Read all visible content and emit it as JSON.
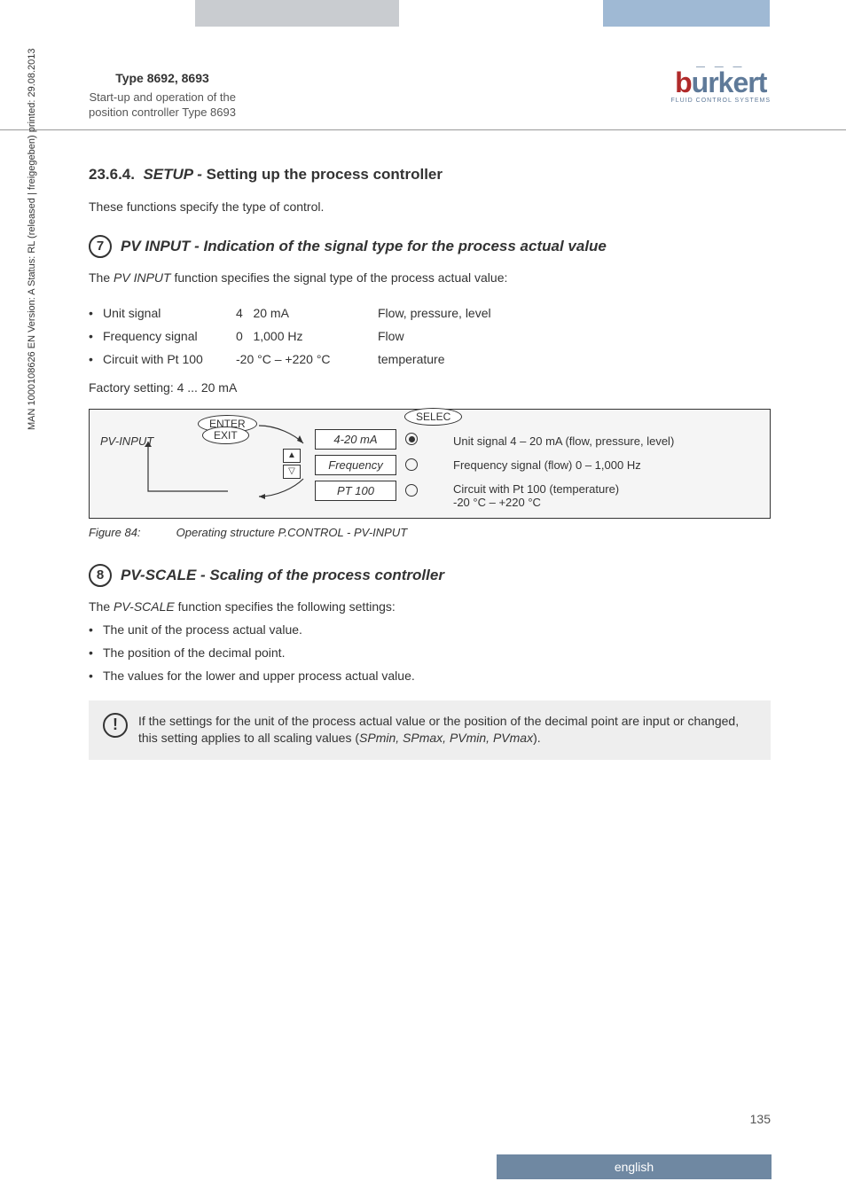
{
  "header": {
    "type_line": "Type 8692, 8693",
    "sub_line1": "Start-up and operation of the",
    "sub_line2": "position controller Type 8693"
  },
  "brand": {
    "name1": "b",
    "name2": "urkert",
    "tag": "FLUID CONTROL SYSTEMS"
  },
  "side_text": "MAN 1000108626 EN Version: A Status: RL (released | freigegeben) printed: 29.08.2013",
  "section": {
    "num": "23.6.4.",
    "title_ital": "SETUP -",
    "title_rest": " Setting up the process controller",
    "intro": "These functions specify the type of control."
  },
  "step7": {
    "num": "7",
    "title": "PV INPUT - Indication of the signal type for the process actual value",
    "lead_pre": "The ",
    "lead_ital": "PV INPUT",
    "lead_post": " function specifies the signal type of the process actual value:",
    "rows": [
      {
        "c1": "Unit signal",
        "c2a": "4",
        "c2b": "20 mA",
        "c3": "Flow, pressure, level"
      },
      {
        "c1": "Frequency signal",
        "c2a": "0",
        "c2b": "1,000 Hz",
        "c3": "Flow"
      },
      {
        "c1": "Circuit with Pt 100",
        "c2a": "",
        "c2b": "-20 °C – +220 °C",
        "c3": "temperature"
      }
    ],
    "factory": "Factory setting: 4 ... 20 mA"
  },
  "diagram": {
    "pv_label": "PV-INPUT",
    "enter": "ENTER",
    "exit": "EXIT",
    "select": "SELEC",
    "options": [
      {
        "label": "4-20  mA",
        "selected": true,
        "desc": "Unit signal 4 – 20 mA (flow, pressure, level)"
      },
      {
        "label": "Frequency",
        "selected": false,
        "desc": "Frequency signal (flow) 0 – 1,000 Hz"
      },
      {
        "label": "PT 100",
        "selected": false,
        "desc": "Circuit with Pt 100 (temperature)\n-20 °C – +220 °C"
      }
    ]
  },
  "fig84": {
    "num": "Figure 84:",
    "text": "Operating structure P.CONTROL - PV-INPUT"
  },
  "step8": {
    "num": "8",
    "title": "PV-SCALE - Scaling of the process controller",
    "lead_pre": "The ",
    "lead_ital": "PV-SCALE",
    "lead_post": " function specifies the following settings:",
    "items": [
      "The unit of the process actual value.",
      "The position of the decimal point.",
      "The values for the lower and upper process actual value."
    ]
  },
  "notice": {
    "text_pre": "If the settings for the unit of the process actual value or the position of the decimal point are input or changed, this setting applies to all scaling values (",
    "text_ital": "SPmin, SPmax, PVmin, PVmax",
    "text_post": ")."
  },
  "page_num": "135",
  "lang": "english"
}
